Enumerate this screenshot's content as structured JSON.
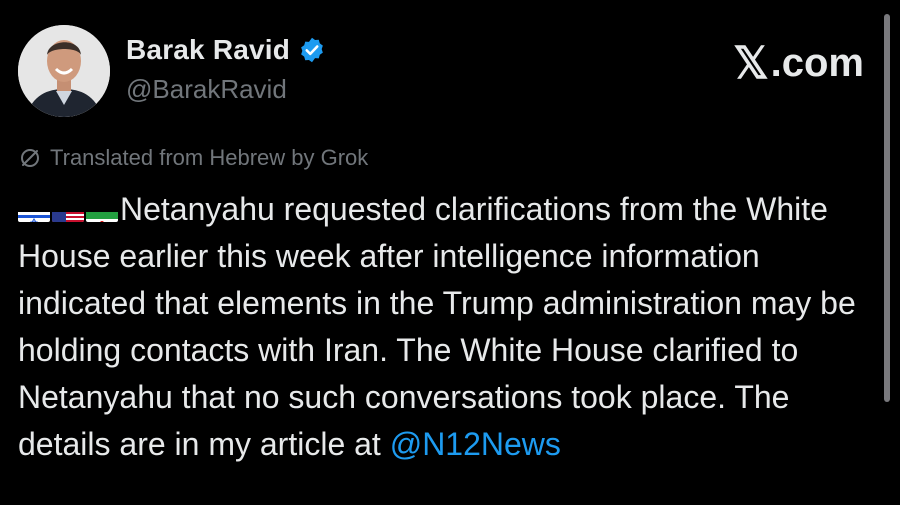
{
  "author": {
    "display_name": "Barak Ravid",
    "handle": "@BarakRavid"
  },
  "brand": {
    "label": ".com"
  },
  "translation": {
    "label": "Translated from Hebrew by Grok"
  },
  "tweet": {
    "flags": [
      "israel-flag-icon",
      "usa-flag-icon",
      "iran-flag-icon"
    ],
    "text": "Netanyahu requested clarifications from the White House earlier this week after intelligence information indicated that elements in the Trump administration may be holding contacts with Iran. The White House clarified to Netanyahu that no such conversations took place. The details are in my article at ",
    "mention": "@N12News"
  },
  "colors": {
    "background": "#000000",
    "text": "#e7e9ea",
    "secondary": "#71767b",
    "link": "#1d9bf0",
    "verified": "#1d9bf0"
  }
}
